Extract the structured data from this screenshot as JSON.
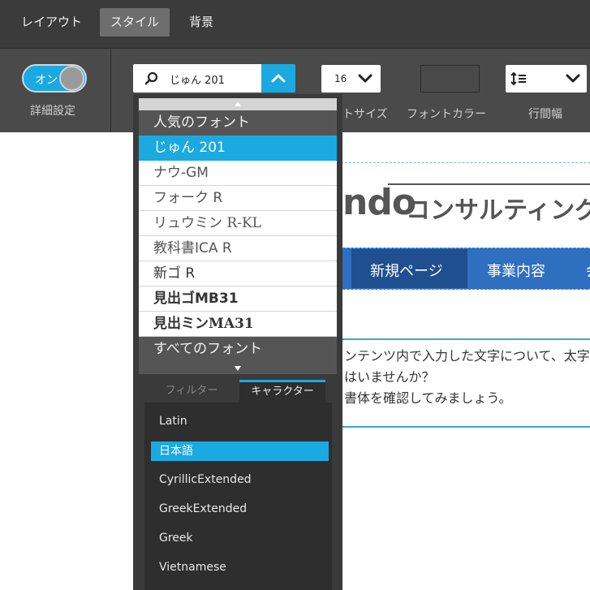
{
  "tabs": [
    {
      "label": "レイアウト",
      "active": false
    },
    {
      "label": "スタイル",
      "active": true
    },
    {
      "label": "背景",
      "active": false
    }
  ],
  "toolbar": {
    "toggle": {
      "label": "オン",
      "state": "on"
    },
    "detail_caption": "詳細設定",
    "font_field": {
      "value": "じゅん 201",
      "icon": "search-icon"
    },
    "size_select": {
      "value": "16",
      "caption": "トサイズ"
    },
    "color_caption": "フォントカラー",
    "line_height_caption": "行間幅",
    "line_height_icon": "line-height-icon"
  },
  "colors": {
    "accent": "#1ba9e1",
    "toolbar_bg": "#4a4a4a",
    "tabbar_bg": "#3b3b3b",
    "nav_bg": "#2f6fc0"
  },
  "font_dropdown": {
    "header": "人気のフォント",
    "footer": "すべてのフォント",
    "fonts": [
      {
        "label": "じゅん 201",
        "selected": true
      },
      {
        "label": "ナウ-GM",
        "selected": false
      },
      {
        "label": "フォーク R",
        "selected": false
      },
      {
        "label": "リュウミン R-KL",
        "selected": false
      },
      {
        "label": "教科書ICA R",
        "selected": false
      },
      {
        "label": "新ゴ R",
        "selected": false
      },
      {
        "label": "見出ゴMB31",
        "selected": false
      },
      {
        "label": "見出ミンMA31",
        "selected": false
      }
    ],
    "subtabs": [
      {
        "label": "フィルター",
        "active": false
      },
      {
        "label": "キャラクター",
        "active": true
      }
    ],
    "character_sets": [
      {
        "label": "Latin",
        "selected": false
      },
      {
        "label": "日本語",
        "selected": true
      },
      {
        "label": "CyrillicExtended",
        "selected": false
      },
      {
        "label": "GreekExtended",
        "selected": false
      },
      {
        "label": "Greek",
        "selected": false
      },
      {
        "label": "Vietnamese",
        "selected": false
      }
    ]
  },
  "preview": {
    "logo_latin": "ndo",
    "logo_kana": "コンサルティング",
    "nav": [
      "新規ページ",
      "事業内容",
      "会"
    ],
    "content_lines": [
      "ンテンツ内で入力した文字について、太字",
      "はいませんか？",
      "書体を確認してみましょう。"
    ]
  }
}
